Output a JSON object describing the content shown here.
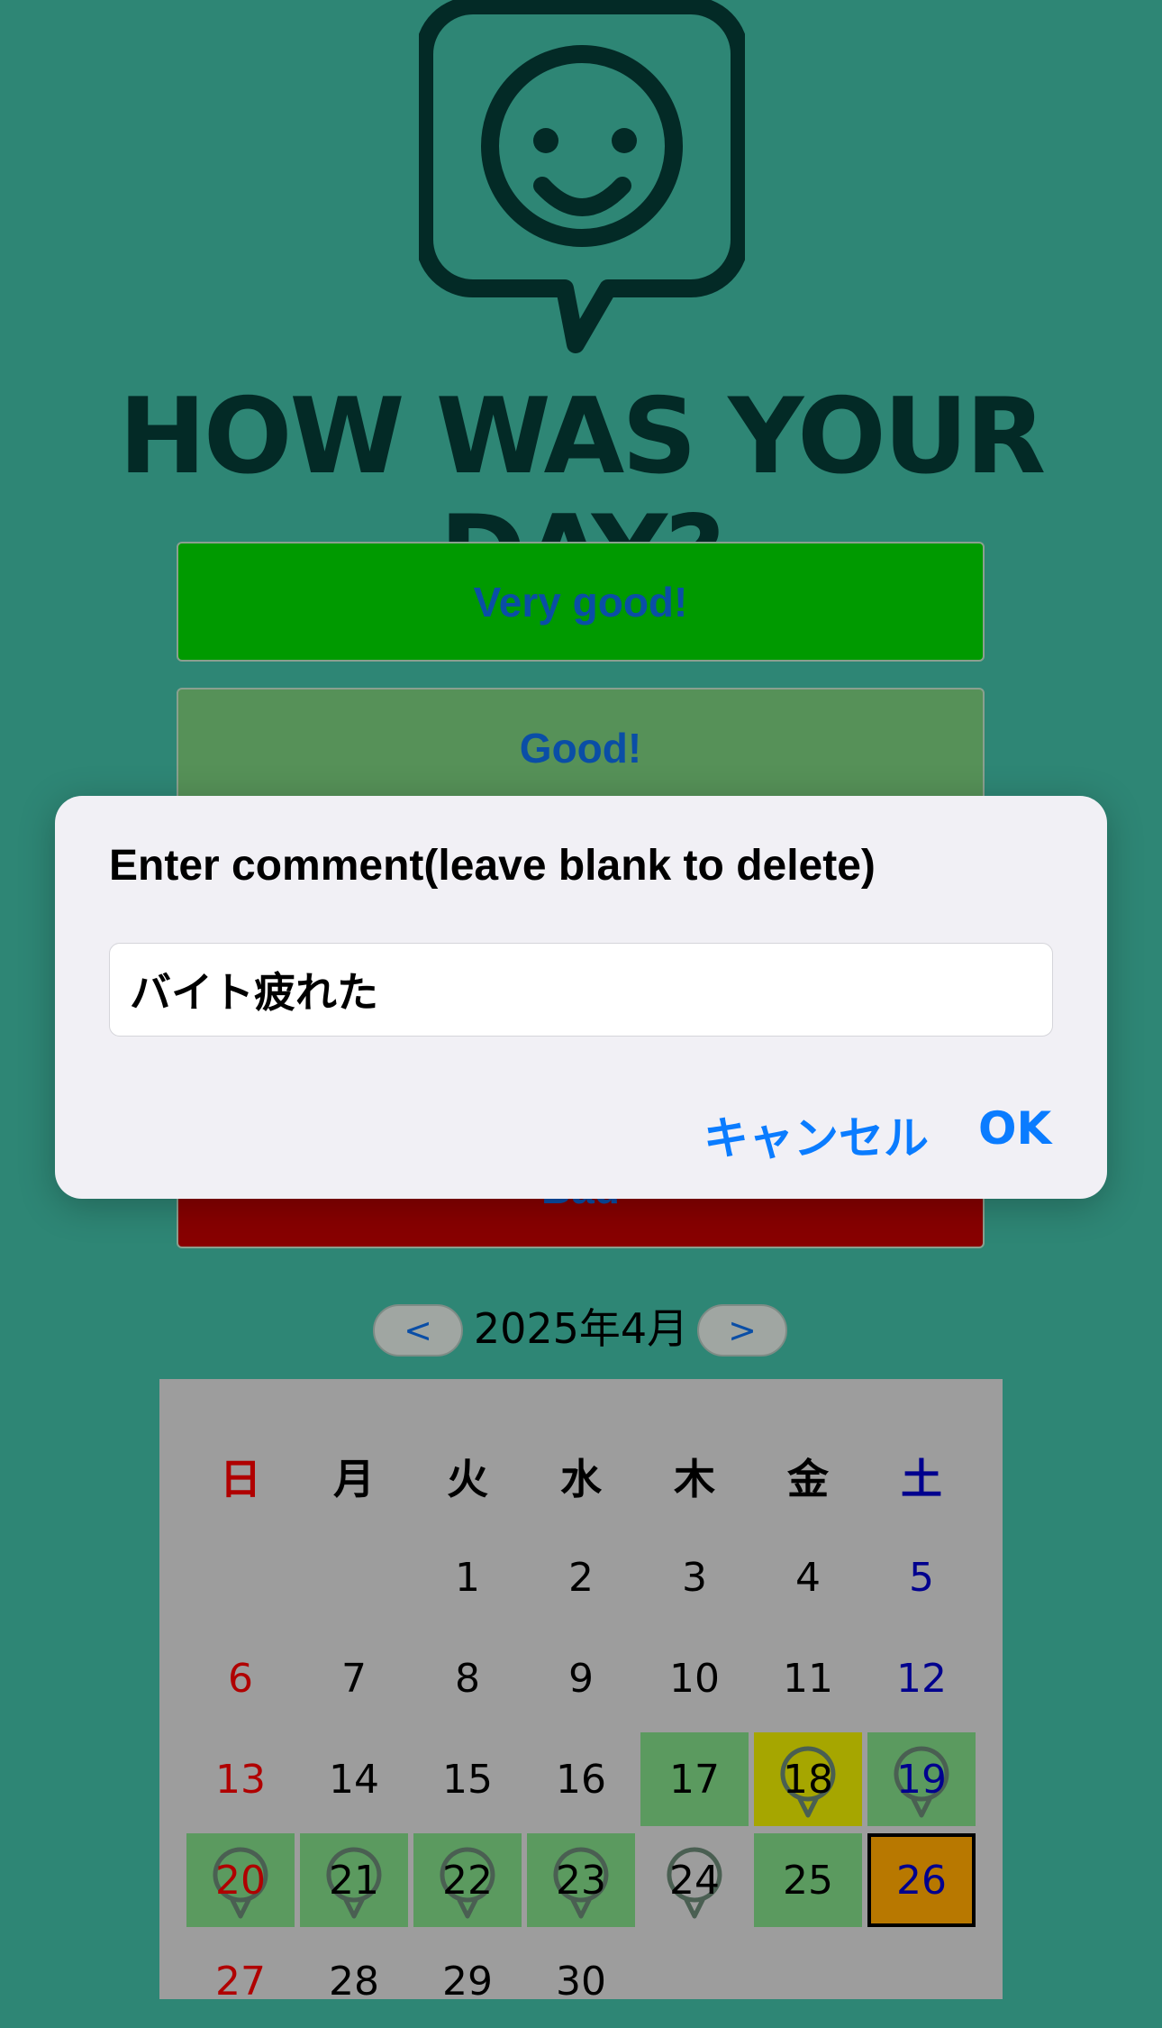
{
  "app": {
    "headline": "HOW WAS YOUR DAY?"
  },
  "mood_buttons": [
    {
      "label": "Very good!",
      "color": "#009a00"
    },
    {
      "label": "Good!",
      "color": "#569158"
    },
    {
      "label": "",
      "color": "#5a8f6a"
    },
    {
      "label": "",
      "color": "#7a6a50"
    },
    {
      "label": "Bad",
      "color": "#880000"
    }
  ],
  "dialog": {
    "title": "Enter comment(leave blank to delete)",
    "input_value": "バイト疲れた",
    "cancel_label": "キャンセル",
    "ok_label": "OK"
  },
  "calendar": {
    "prev_label": "<",
    "next_label": ">",
    "month_label": "2025年4月",
    "weekdays": [
      "日",
      "月",
      "火",
      "水",
      "木",
      "金",
      "土"
    ],
    "days": [
      {
        "day": "1"
      },
      {
        "day": "2"
      },
      {
        "day": "3"
      },
      {
        "day": "4"
      },
      {
        "day": "5"
      },
      {
        "day": "6"
      },
      {
        "day": "7"
      },
      {
        "day": "8"
      },
      {
        "day": "9"
      },
      {
        "day": "10"
      },
      {
        "day": "11"
      },
      {
        "day": "12"
      },
      {
        "day": "13"
      },
      {
        "day": "14"
      },
      {
        "day": "15"
      },
      {
        "day": "16"
      },
      {
        "day": "17",
        "mood_color": "#5b9a5f"
      },
      {
        "day": "18",
        "mood_color": "#a6a600",
        "comment": true
      },
      {
        "day": "19",
        "mood_color": "#5b9a5f",
        "comment": true
      },
      {
        "day": "20",
        "mood_color": "#5b9a5f",
        "comment": true
      },
      {
        "day": "21",
        "mood_color": "#5b9a5f",
        "comment": true
      },
      {
        "day": "22",
        "mood_color": "#5b9a5f",
        "comment": true
      },
      {
        "day": "23",
        "mood_color": "#5b9a5f",
        "comment": true
      },
      {
        "day": "24",
        "comment": true
      },
      {
        "day": "25",
        "mood_color": "#5b9a5f"
      },
      {
        "day": "26",
        "mood_color": "#b87800",
        "today": true
      },
      {
        "day": "27"
      },
      {
        "day": "28"
      },
      {
        "day": "29"
      },
      {
        "day": "30"
      }
    ],
    "colors": {
      "sunday": "#b00000",
      "saturday": "#00008e",
      "good": "#5b9a5f",
      "okay": "#a6a600",
      "today": "#b87800"
    }
  }
}
